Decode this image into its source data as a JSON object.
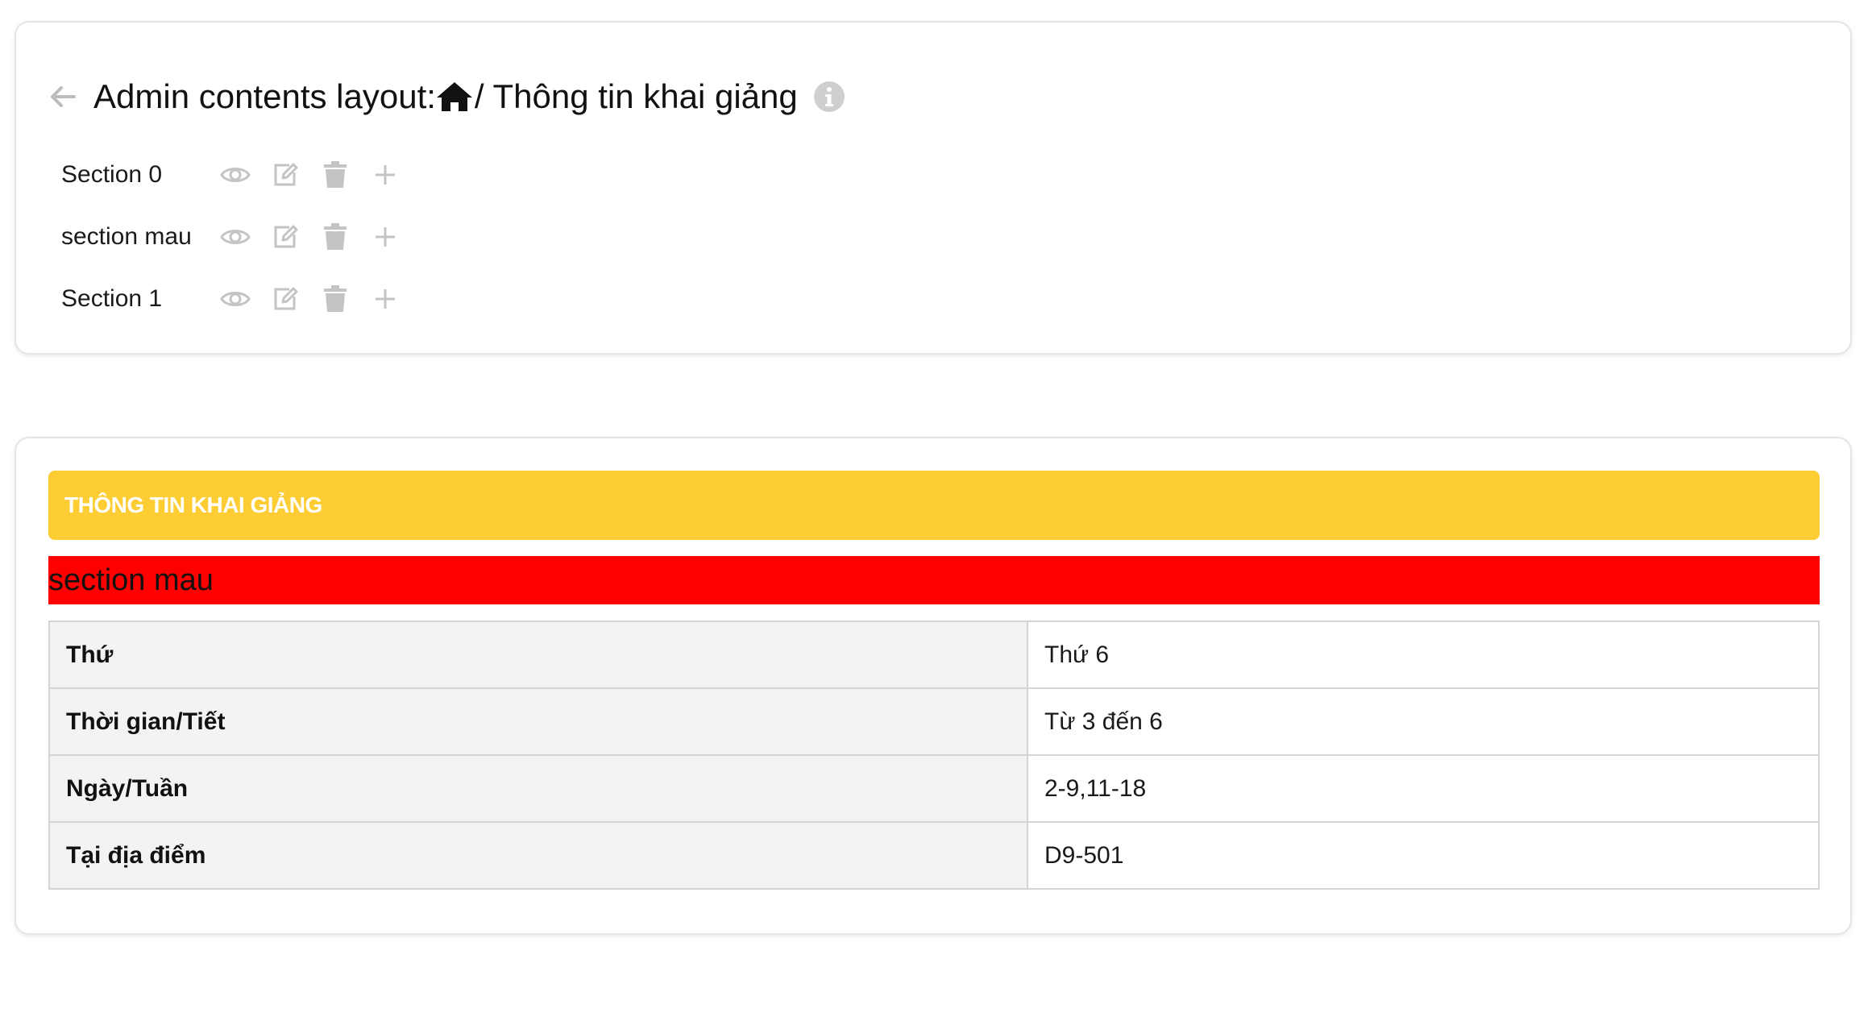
{
  "header": {
    "title_prefix": "Admin contents layout:",
    "title_suffix": "/ Thông tin khai giảng",
    "back_icon": "arrow-left-icon",
    "home_icon": "home-icon",
    "info_icon": "info-circle-icon"
  },
  "sections": [
    {
      "label": "Section 0"
    },
    {
      "label": "section mau"
    },
    {
      "label": "Section 1"
    }
  ],
  "section_action_icons": [
    "eye-icon",
    "edit-icon",
    "trash-icon",
    "plus-icon"
  ],
  "preview": {
    "banner_title": "THÔNG TIN KHAI GIẢNG",
    "section_heading": "section mau",
    "table": [
      {
        "key": "Thứ",
        "value": "Thứ 6"
      },
      {
        "key": "Thời gian/Tiết",
        "value": "Từ 3 đến 6"
      },
      {
        "key": "Ngày/Tuần",
        "value": "2-9,11-18"
      },
      {
        "key": "Tại địa điểm",
        "value": "D9-501"
      }
    ]
  },
  "colors": {
    "banner_yellow": "#fecd33",
    "banner_red": "#ff0000",
    "icon_gray": "#c4c4c4",
    "table_key_bg": "#f3f3f3",
    "table_border": "#d4d4d4"
  }
}
